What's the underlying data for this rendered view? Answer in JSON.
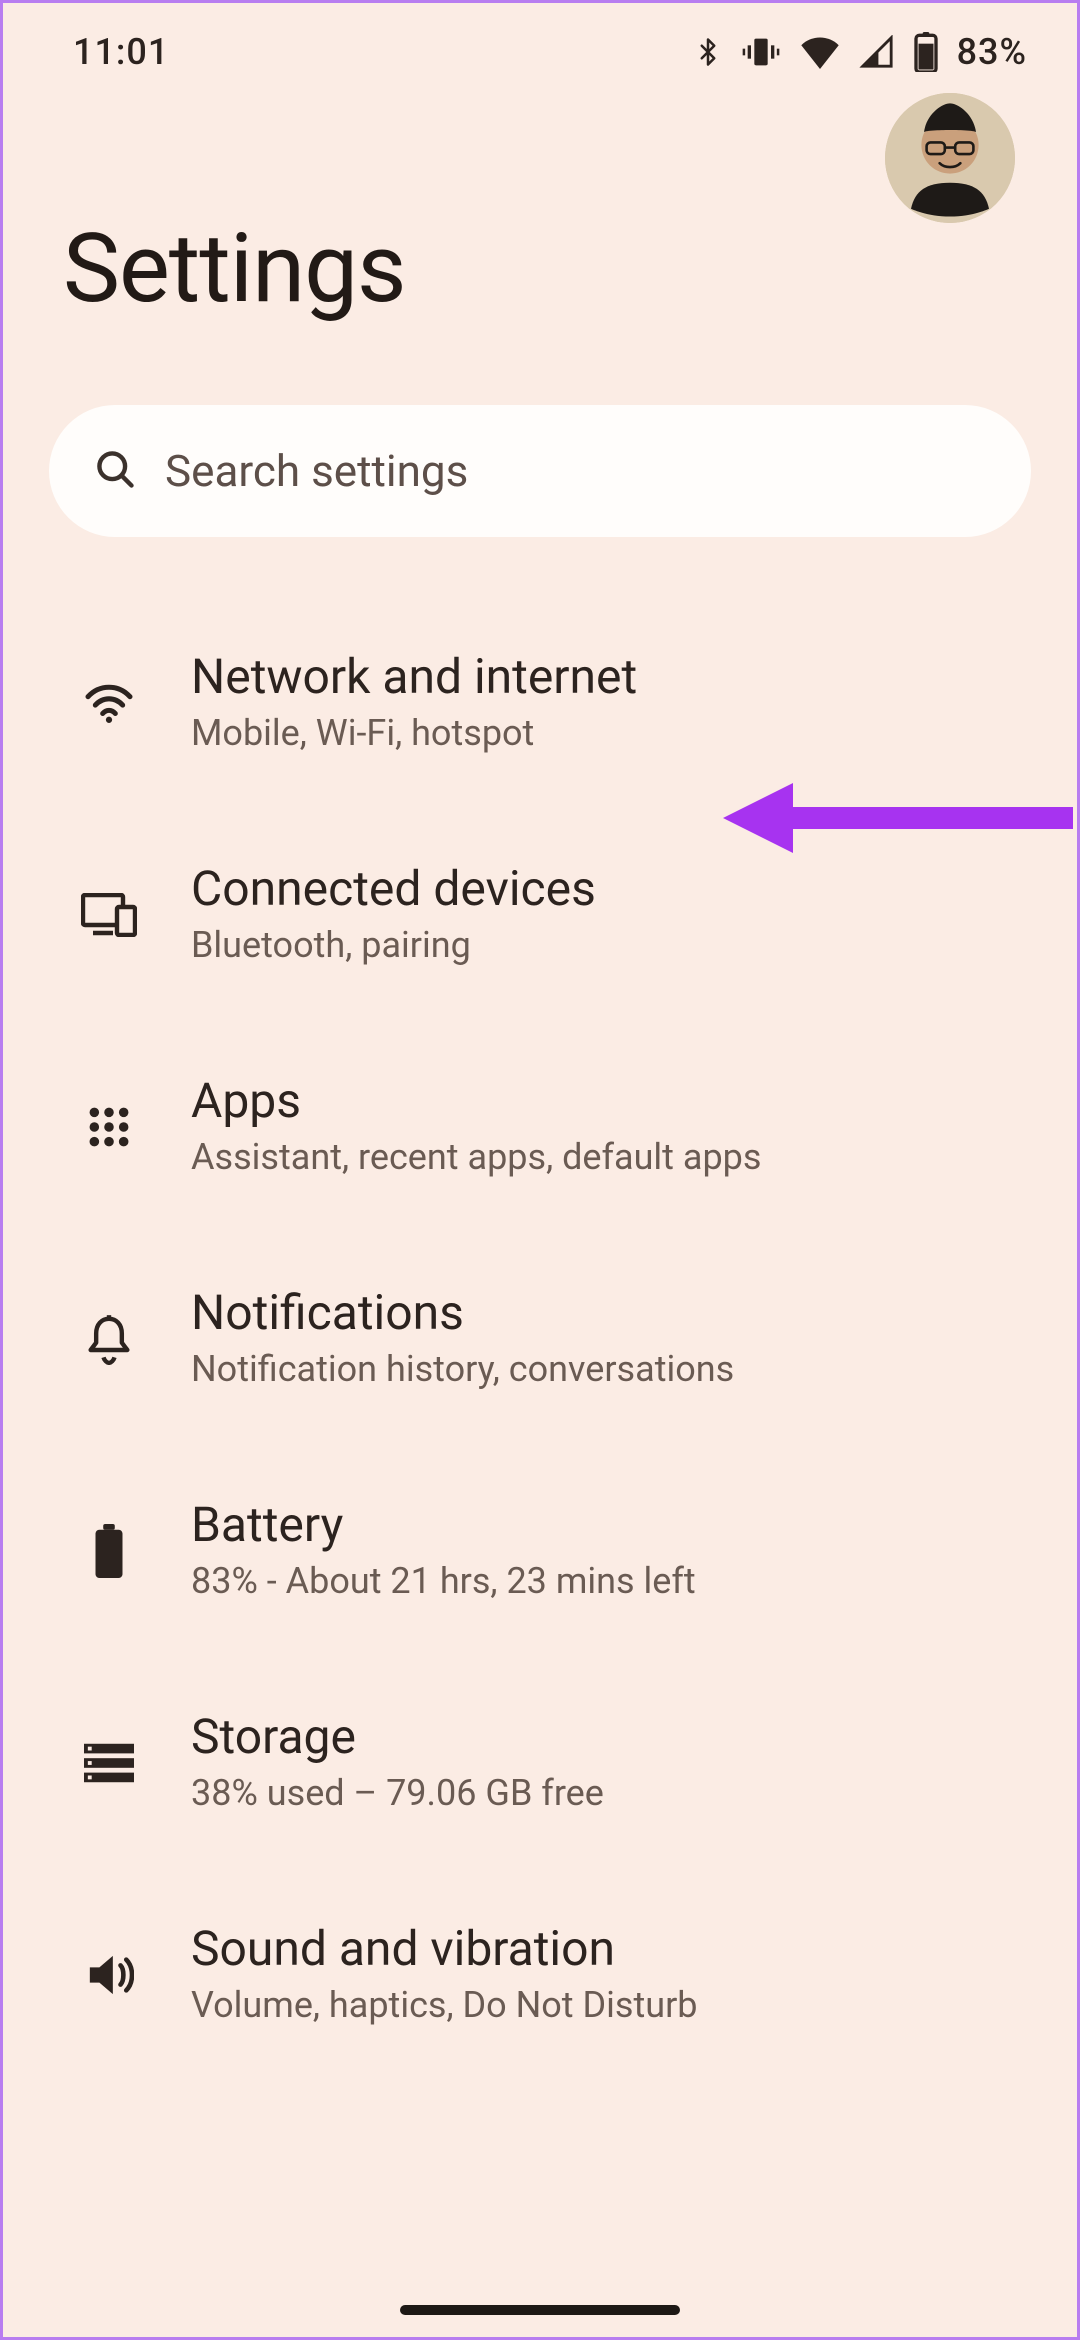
{
  "status": {
    "time": "11:01",
    "battery_pct": "83%"
  },
  "header": {
    "title": "Settings"
  },
  "search": {
    "placeholder": "Search settings"
  },
  "items": [
    {
      "id": "network",
      "icon": "wifi",
      "title": "Network and internet",
      "sub": "Mobile, Wi-Fi, hotspot"
    },
    {
      "id": "connected",
      "icon": "devices",
      "title": "Connected devices",
      "sub": "Bluetooth, pairing"
    },
    {
      "id": "apps",
      "icon": "apps",
      "title": "Apps",
      "sub": "Assistant, recent apps, default apps"
    },
    {
      "id": "notifications",
      "icon": "bell",
      "title": "Notifications",
      "sub": "Notification history, conversations"
    },
    {
      "id": "battery",
      "icon": "battery",
      "title": "Battery",
      "sub": "83% - About 21 hrs, 23 mins left"
    },
    {
      "id": "storage",
      "icon": "storage",
      "title": "Storage",
      "sub": "38% used – 79.06 GB free"
    },
    {
      "id": "sound",
      "icon": "sound",
      "title": "Sound and vibration",
      "sub": "Volume, haptics, Do Not Disturb"
    }
  ],
  "annotation": {
    "color": "#a733f0"
  }
}
